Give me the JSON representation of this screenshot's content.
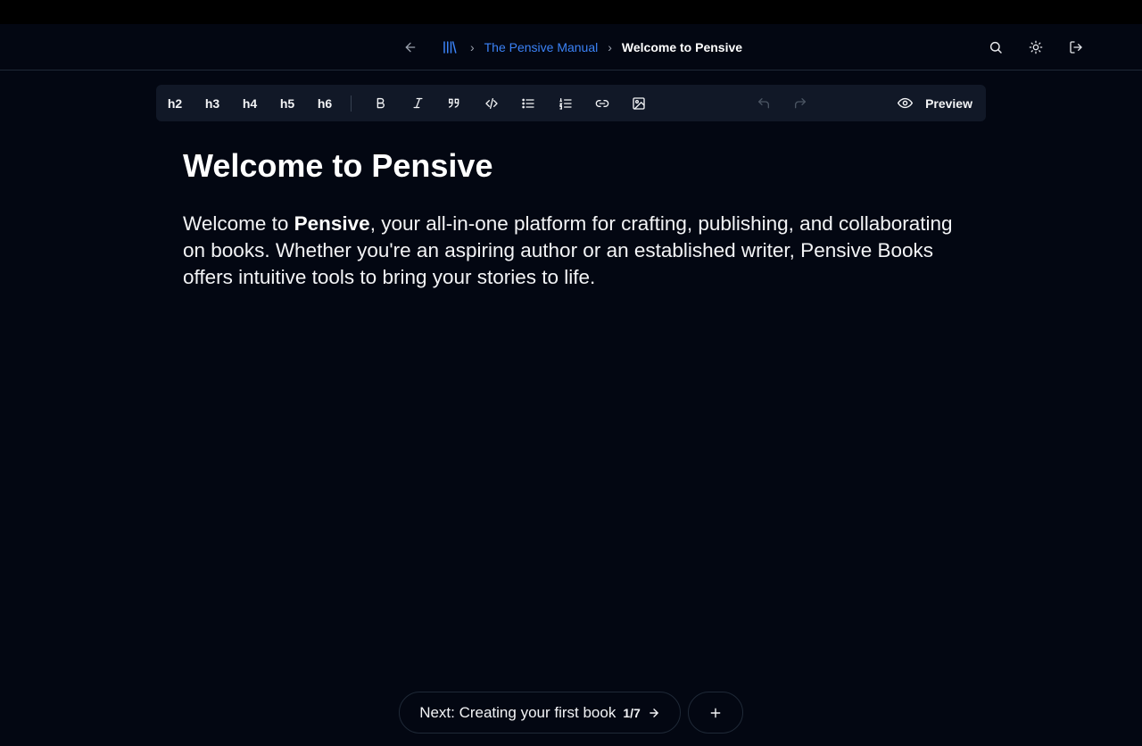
{
  "breadcrumb": {
    "book": "The Pensive Manual",
    "separator": "›",
    "page": "Welcome to Pensive"
  },
  "header_icons": [
    "back-arrow-icon",
    "library-icon",
    "search-icon",
    "sun-icon",
    "logout-icon"
  ],
  "toolbar": {
    "headings": [
      "h2",
      "h3",
      "h4",
      "h5",
      "h6"
    ],
    "format_icons": [
      "bold-icon",
      "italic-icon",
      "quote-icon",
      "code-icon",
      "bullet-list-icon",
      "ordered-list-icon",
      "link-icon",
      "image-icon"
    ],
    "history_icons": [
      "undo-icon",
      "redo-icon"
    ],
    "preview_label": "Preview"
  },
  "document": {
    "title": "Welcome to Pensive",
    "para_before": "Welcome to ",
    "para_bold": "Pensive",
    "para_after": ", your all-in-one platform for crafting, publishing, and collaborating on books. Whether you're an aspiring author or an established writer, Pensive Books offers intuitive tools to bring your stories to life."
  },
  "footer": {
    "next_label": "Next: Creating your first book",
    "page_count": "1/7",
    "add_icon": "plus-icon"
  },
  "colors": {
    "background": "#030712",
    "accent": "#3b82f6",
    "toolbar": "#111827"
  }
}
